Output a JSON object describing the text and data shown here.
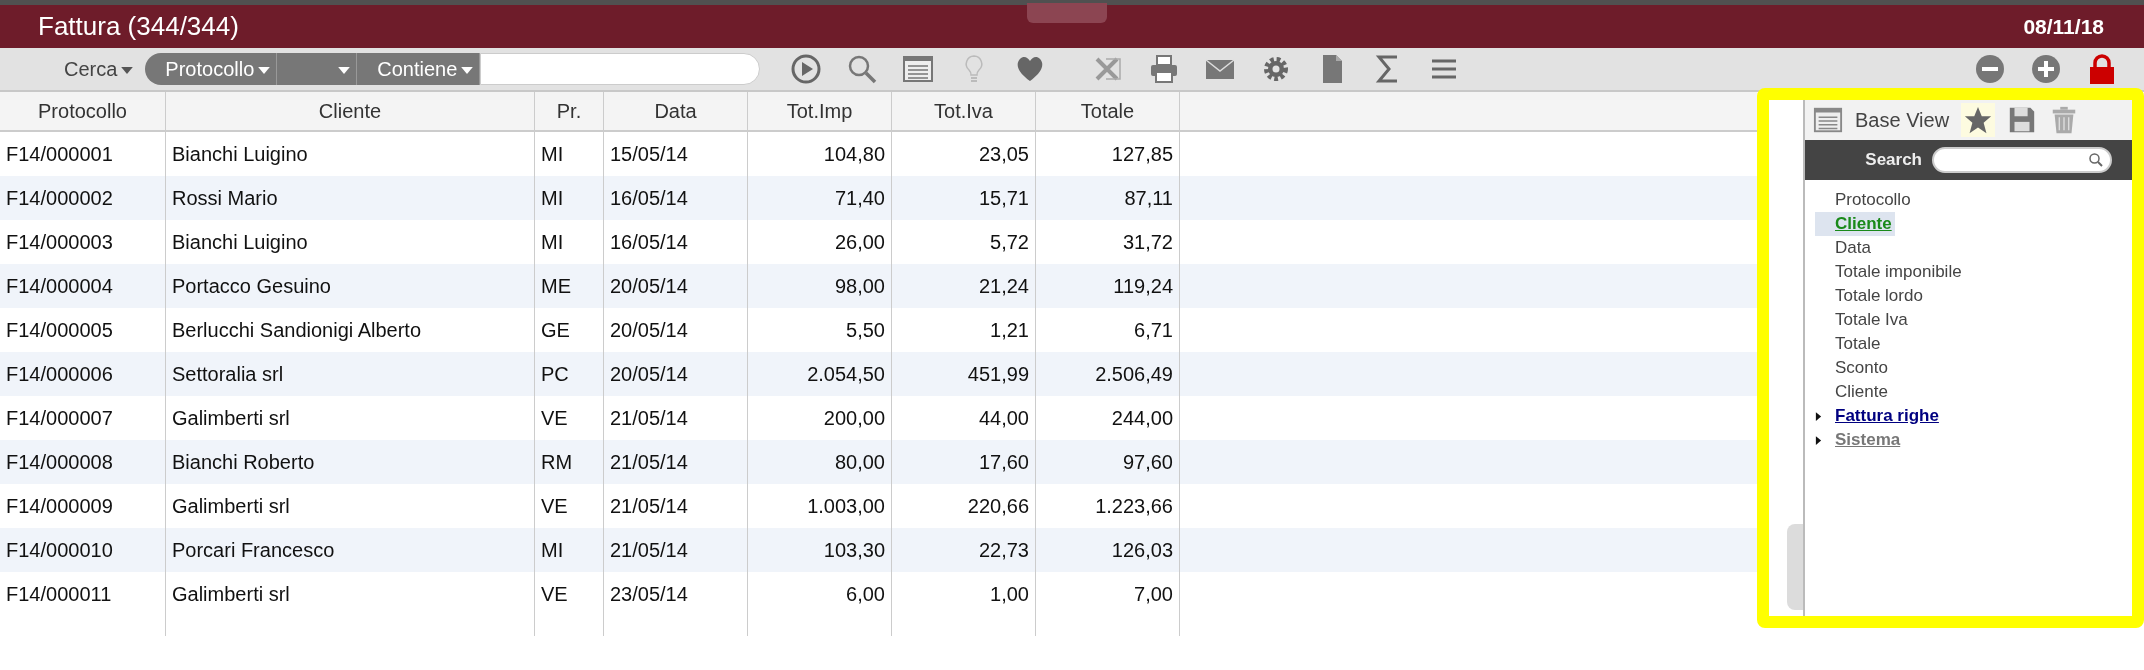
{
  "window": {
    "title": "Fattura (344/344)",
    "date": "08/11/18"
  },
  "search_bar": {
    "mode": "Cerca",
    "field": "Protocollo",
    "condition": "Contiene"
  },
  "table": {
    "columns": [
      {
        "label": "Protocollo",
        "kind": "text"
      },
      {
        "label": "Cliente",
        "kind": "text"
      },
      {
        "label": "Pr.",
        "kind": "text"
      },
      {
        "label": "Data",
        "kind": "text"
      },
      {
        "label": "Tot.Imp",
        "kind": "number"
      },
      {
        "label": "Tot.Iva",
        "kind": "number"
      },
      {
        "label": "Totale",
        "kind": "number"
      }
    ],
    "rows": [
      [
        "F14/000001",
        "Bianchi Luigino",
        "MI",
        "15/05/14",
        "104,80",
        "23,05",
        "127,85"
      ],
      [
        "F14/000002",
        "Rossi Mario",
        "MI",
        "16/05/14",
        "71,40",
        "15,71",
        "87,11"
      ],
      [
        "F14/000003",
        "Bianchi Luigino",
        "MI",
        "16/05/14",
        "26,00",
        "5,72",
        "31,72"
      ],
      [
        "F14/000004",
        "Portacco Gesuino",
        "ME",
        "20/05/14",
        "98,00",
        "21,24",
        "119,24"
      ],
      [
        "F14/000005",
        "Berlucchi Sandionigi Alberto",
        "GE",
        "20/05/14",
        "5,50",
        "1,21",
        "6,71"
      ],
      [
        "F14/000006",
        "Settoralia srl",
        "PC",
        "20/05/14",
        "2.054,50",
        "451,99",
        "2.506,49"
      ],
      [
        "F14/000007",
        "Galimberti srl",
        "VE",
        "21/05/14",
        "200,00",
        "44,00",
        "244,00"
      ],
      [
        "F14/000008",
        "Bianchi Roberto",
        "RM",
        "21/05/14",
        "80,00",
        "17,60",
        "97,60"
      ],
      [
        "F14/000009",
        "Galimberti srl",
        "VE",
        "21/05/14",
        "1.003,00",
        "220,66",
        "1.223,66"
      ],
      [
        "F14/000010",
        "Porcari Francesco",
        "MI",
        "21/05/14",
        "103,30",
        "22,73",
        "126,03"
      ],
      [
        "F14/000011",
        "Galimberti srl",
        "VE",
        "23/05/14",
        "6,00",
        "1,00",
        "7,00"
      ]
    ]
  },
  "view_panel": {
    "title": "Base View",
    "search_label": "Search",
    "fields": [
      {
        "label": "Protocollo",
        "selected": false
      },
      {
        "label": "Cliente",
        "selected": true
      },
      {
        "label": "Data",
        "selected": false
      },
      {
        "label": "Totale imponibile",
        "selected": false
      },
      {
        "label": "Totale lordo",
        "selected": false
      },
      {
        "label": "Totale Iva",
        "selected": false
      },
      {
        "label": "Totale",
        "selected": false
      },
      {
        "label": "Sconto",
        "selected": false
      },
      {
        "label": "Cliente",
        "selected": false
      }
    ],
    "groups": [
      {
        "label": "Fattura righe",
        "expanded": false,
        "disabled": false
      },
      {
        "label": "Sistema",
        "expanded": false,
        "disabled": true
      }
    ]
  }
}
